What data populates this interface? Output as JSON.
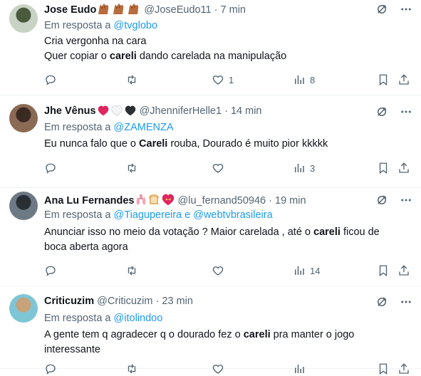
{
  "tweets": [
    {
      "name": "Jose Eudo",
      "handle": "@JoseEudo11",
      "sep": "·",
      "time": "7 min",
      "reply_prefix": "Em resposta a",
      "reply_to": "@tvglobo",
      "lines": [
        {
          "parts": [
            {
              "t": "Cria vergonha na cara",
              "b": false
            }
          ]
        },
        {
          "parts": [
            {
              "t": "Quer copiar o ",
              "b": false
            },
            {
              "t": "careli",
              "b": true
            },
            {
              "t": " dando carelada na manipulação",
              "b": false
            }
          ]
        }
      ],
      "counts": {
        "reply": "",
        "retweet": "",
        "like": "1",
        "views": "8"
      },
      "avatar_colors": [
        "#c9d3c4",
        "#4a5b3d"
      ],
      "emojis": [
        "raised-hands-icon",
        "raised-hands-icon",
        "raised-hands-icon"
      ]
    },
    {
      "name": "Jhe Vênus",
      "handle": "@JhenniferHelle1",
      "sep": "·",
      "time": "14 min",
      "reply_prefix": "Em resposta a",
      "reply_to": "@ZAMENZA",
      "lines": [
        {
          "parts": [
            {
              "t": "Eu nunca falo que o ",
              "b": false
            },
            {
              "t": "Careli",
              "b": true
            },
            {
              "t": " rouba, Dourado é muito pior kkkkk",
              "b": false
            }
          ]
        }
      ],
      "counts": {
        "reply": "",
        "retweet": "",
        "like": "",
        "views": "3"
      },
      "avatar_colors": [
        "#8a6a55",
        "#3b2a22"
      ],
      "emojis": [
        "red-heart-icon",
        "white-heart-icon",
        "black-heart-icon"
      ]
    },
    {
      "name": "Ana Lu Fernandes",
      "handle": "@lu_fernand50946",
      "sep": "·",
      "time": "19 min",
      "reply_prefix": "Em resposta a",
      "reply_to": "@Tiagupereira e @webtvbrasileira",
      "lines": [
        {
          "parts": [
            {
              "t": "Anunciar isso no meio da votação ? Maior carelada , até o ",
              "b": false
            },
            {
              "t": "careli",
              "b": true
            },
            {
              "t": " ficou de",
              "b": false
            }
          ]
        },
        {
          "parts": [
            {
              "t": "boca aberta agora",
              "b": false
            }
          ]
        }
      ],
      "counts": {
        "reply": "",
        "retweet": "",
        "like": "",
        "views": "14"
      },
      "avatar_colors": [
        "#6d7a86",
        "#2a2f35"
      ],
      "emojis": [
        "lungs-icon",
        "bread-icon",
        "heart-with-ribbon-icon"
      ]
    },
    {
      "name": "Criticuzim",
      "handle": "@Criticuzim",
      "sep": "·",
      "time": "23 min",
      "reply_prefix": "Em resposta a",
      "reply_to": "@itolindoo",
      "lines": [
        {
          "parts": [
            {
              "t": "A gente tem q agradecer q o dourado fez o ",
              "b": false
            },
            {
              "t": "careli",
              "b": true
            },
            {
              "t": " pra manter o jogo",
              "b": false
            }
          ]
        },
        {
          "parts": [
            {
              "t": "interessante",
              "b": false
            }
          ]
        }
      ],
      "counts": {
        "reply": "",
        "retweet": "",
        "like": "",
        "views": ""
      },
      "avatar_colors": [
        "#7ec6d6",
        "#c7a27a"
      ],
      "emojis": []
    }
  ],
  "icons": {
    "grok": "grok-icon",
    "more": "more-options-icon",
    "reply": "reply-icon",
    "retweet": "retweet-icon",
    "like": "like-icon",
    "views": "views-icon",
    "bookmark": "bookmark-icon",
    "share": "share-icon"
  },
  "colors": {
    "link": "#1d9bf0",
    "muted": "#536471",
    "text": "#0f1419",
    "divider": "#eff3f4"
  }
}
